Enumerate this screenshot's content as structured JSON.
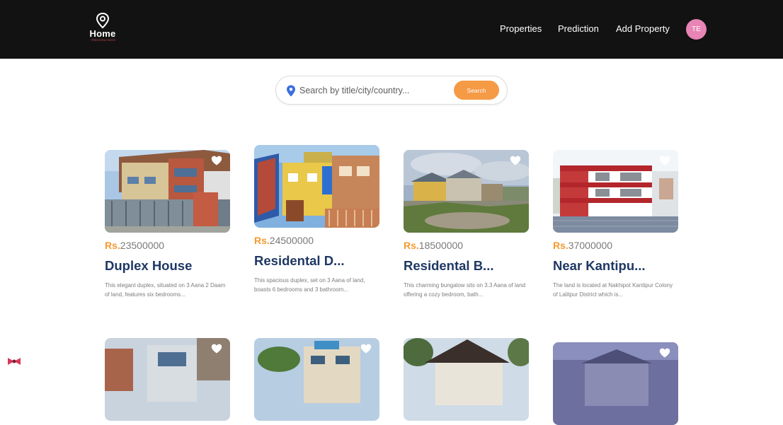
{
  "header": {
    "logo_text": "Home",
    "logo_tagline": "PREDICTING RATES",
    "nav": [
      "Properties",
      "Prediction",
      "Add Property"
    ],
    "avatar_initials": "TE"
  },
  "search": {
    "placeholder": "Search by title/city/country...",
    "button_label": "Search"
  },
  "listings": [
    {
      "currency": "Rs.",
      "price": "23500000",
      "title": "Duplex House",
      "description": "This elegant duplex, situated on 3 Aana 2 Daam of land, features six bedrooms..."
    },
    {
      "currency": "Rs.",
      "price": "24500000",
      "title": "Residental D...",
      "description": "This spacious duplex, set on 3 Aana of land, boasts 6 bedrooms and 3 bathroom..."
    },
    {
      "currency": "Rs.",
      "price": "18500000",
      "title": "Residental B...",
      "description": "This charming bungalow sits on 3.3 Aana of land offering a cozy bedroom, bath..."
    },
    {
      "currency": "Rs.",
      "price": "37000000",
      "title": "Near Kantipu...",
      "description": "The land is located at Nakhipot Kantipur Colony of Lalitpur District which is..."
    }
  ],
  "colors": {
    "header_bg": "#121212",
    "accent_orange": "#f59a45",
    "title_navy": "#1f3864",
    "avatar_pink": "#e884b6"
  }
}
